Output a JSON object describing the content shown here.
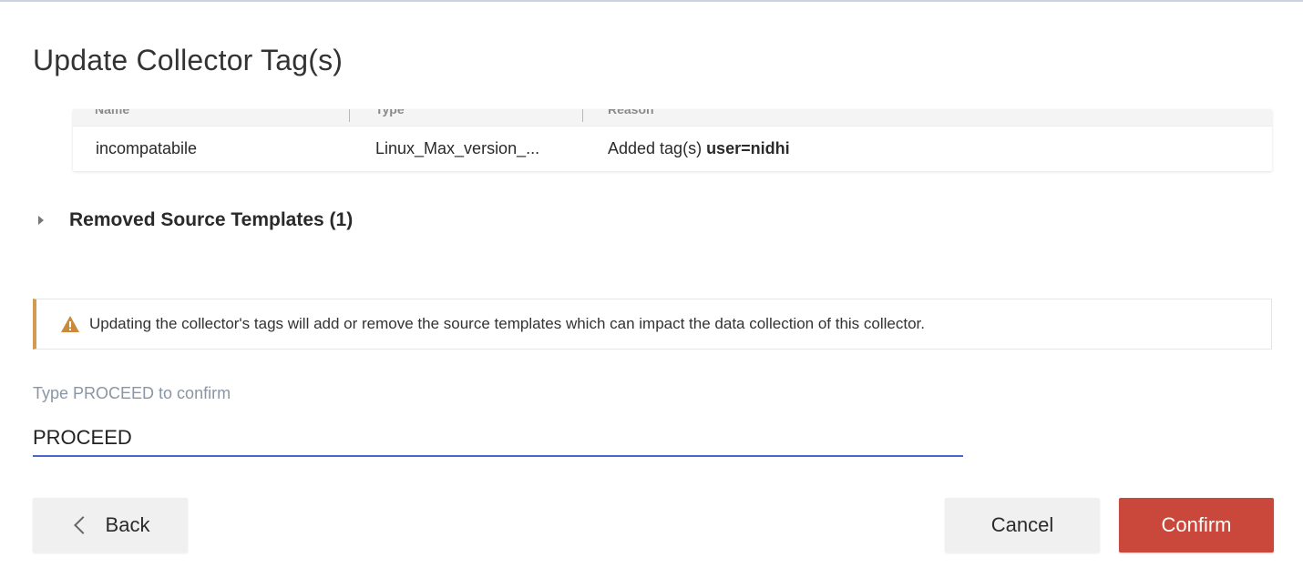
{
  "dialog": {
    "title": "Update Collector Tag(s)"
  },
  "table": {
    "columns": [
      "Name",
      "Type",
      "Reason"
    ],
    "rows": [
      {
        "name": "incompatabile",
        "type": "Linux_Max_version_...",
        "reason_prefix": "Added tag(s) ",
        "reason_tag": "user=nidhi"
      }
    ]
  },
  "removed_section": {
    "label": "Removed Source Templates (1)",
    "icon": "caret-right-icon"
  },
  "alert": {
    "icon": "warning-icon",
    "text": "Updating the collector's tags will add or remove the source templates which can impact the data collection of this collector.",
    "accent_color": "#d39a52"
  },
  "confirm_field": {
    "label": "Type PROCEED to confirm",
    "value": "PROCEED",
    "underline_color": "#4b68c9"
  },
  "buttons": {
    "back": "Back",
    "cancel": "Cancel",
    "confirm": "Confirm",
    "confirm_color": "#c9473b"
  }
}
